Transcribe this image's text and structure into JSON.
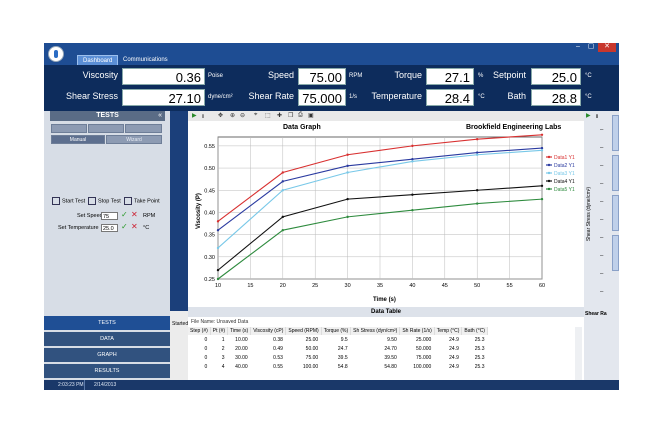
{
  "tabs": [
    "Dashboard",
    "Communications"
  ],
  "window_controls": [
    "–",
    "▢",
    "✕"
  ],
  "readouts": {
    "viscosity": {
      "label": "Viscosity",
      "value": "0.36",
      "unit": "Poise"
    },
    "speed": {
      "label": "Speed",
      "value": "75.00",
      "unit": "RPM"
    },
    "torque": {
      "label": "Torque",
      "value": "27.1",
      "unit": "%"
    },
    "setpoint": {
      "label": "Setpoint",
      "value": "25.0",
      "unit": "°C"
    },
    "shear_stress": {
      "label": "Shear Stress",
      "value": "27.10",
      "unit": "dyne/cm²"
    },
    "shear_rate": {
      "label": "Shear Rate",
      "value": "75.000",
      "unit": "1/s"
    },
    "temperature": {
      "label": "Temperature",
      "value": "28.4",
      "unit": "°C"
    },
    "bath": {
      "label": "Bath",
      "value": "28.8",
      "unit": "°C"
    }
  },
  "tests_panel": {
    "title": "TESTS",
    "mode_buttons": [
      "Manual",
      "Wizard"
    ],
    "control_buttons": [
      "Start Test",
      "Stop Test",
      "Take Point"
    ],
    "set_speed": {
      "label": "Set Speed",
      "value": "75",
      "unit": "RPM"
    },
    "set_temperature": {
      "label": "Set Temperature",
      "value": "25.0",
      "unit": "°C"
    }
  },
  "nav": [
    "TESTS",
    "DATA",
    "GRAPH",
    "RESULTS"
  ],
  "status_side": "Started",
  "status": {
    "time": "2:03:23 PM",
    "date": "2/14/2013"
  },
  "chart_data": {
    "type": "line",
    "title": "Data Graph",
    "subtitle": "Brookfield Engineering Labs",
    "xlabel": "Time (s)",
    "ylabel": "Viscosity (P)",
    "xlim": [
      10,
      60
    ],
    "ylim": [
      0.25,
      0.57
    ],
    "xticks": [
      10,
      15,
      20,
      25,
      30,
      35,
      40,
      45,
      50,
      55,
      60
    ],
    "yticks": [
      0.25,
      0.3,
      0.35,
      0.4,
      0.45,
      0.5,
      0.55
    ],
    "grid": true,
    "legend_position": "right",
    "series": [
      {
        "name": "Data1 Y1",
        "color": "#d83030",
        "x": [
          10,
          20,
          30,
          40,
          50,
          60
        ],
        "y": [
          0.38,
          0.49,
          0.53,
          0.55,
          0.565,
          0.575
        ]
      },
      {
        "name": "Data2 Y1",
        "color": "#2a3aa0",
        "x": [
          10,
          20,
          30,
          40,
          50,
          60
        ],
        "y": [
          0.36,
          0.47,
          0.505,
          0.52,
          0.535,
          0.545
        ]
      },
      {
        "name": "Data3 Y1",
        "color": "#78c8e8",
        "x": [
          10,
          20,
          30,
          40,
          50,
          60
        ],
        "y": [
          0.32,
          0.45,
          0.49,
          0.515,
          0.53,
          0.54
        ]
      },
      {
        "name": "Data4 Y1",
        "color": "#111111",
        "x": [
          10,
          20,
          30,
          40,
          50,
          60
        ],
        "y": [
          0.27,
          0.39,
          0.43,
          0.44,
          0.45,
          0.46
        ]
      },
      {
        "name": "Data5 Y1",
        "color": "#2e8b3e",
        "x": [
          10,
          20,
          30,
          40,
          50,
          60
        ],
        "y": [
          0.25,
          0.36,
          0.39,
          0.405,
          0.42,
          0.43
        ]
      }
    ]
  },
  "data_table": {
    "title": "Data Table",
    "file_name": "File Name: Unsaved Data",
    "columns": [
      "Step (#)",
      "Pt (#)",
      "Time (s)",
      "Viscosity (cP)",
      "Speed (RPM)",
      "Torque (%)",
      "Sh Stress (dyn/cm²)",
      "Sh Rate (1/s)",
      "Temp (°C)",
      "Bath (°C)"
    ],
    "rows": [
      [
        "0",
        "1",
        "10.00",
        "0.38",
        "25.00",
        "9.5",
        "9.50",
        "25.000",
        "24.9",
        "25.3"
      ],
      [
        "0",
        "2",
        "20.00",
        "0.49",
        "50.00",
        "24.7",
        "24.70",
        "50.000",
        "24.9",
        "25.3"
      ],
      [
        "0",
        "3",
        "30.00",
        "0.53",
        "75.00",
        "39.5",
        "39.50",
        "75.000",
        "24.9",
        "25.3"
      ],
      [
        "0",
        "4",
        "40.00",
        "0.55",
        "100.00",
        "54.8",
        "54.80",
        "100.000",
        "24.9",
        "25.3"
      ]
    ]
  },
  "right_panel": {
    "axis_label": "Shear Stress (dyne/cm²)",
    "shear_rate_label": "Shear Ra"
  }
}
